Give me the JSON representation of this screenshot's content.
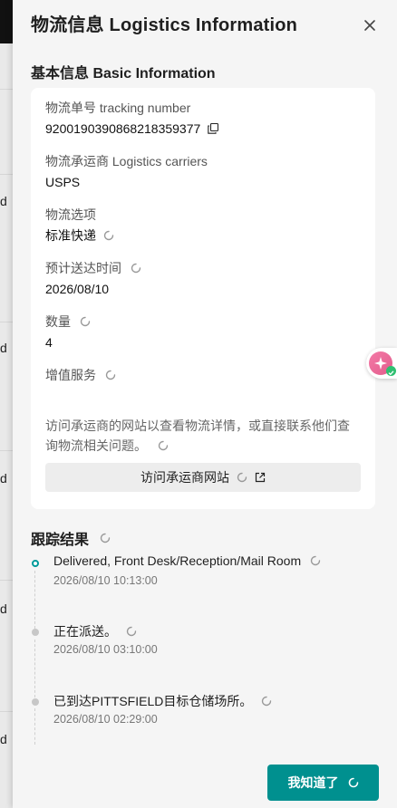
{
  "background": {
    "row_letter": "d"
  },
  "drawer": {
    "title": "物流信息  Logistics Information"
  },
  "basic": {
    "section_title": "基本信息  Basic Information",
    "tracking_label": "物流单号  tracking number",
    "tracking_value": "9200190390868218359377",
    "carrier_label": "物流承运商  Logistics carriers",
    "carrier_value": "USPS",
    "option_label": "物流选项",
    "option_value": "标准快递",
    "eta_label": "预计送达时间",
    "eta_value": "2026/08/10",
    "qty_label": "数量",
    "qty_value": "4",
    "vas_label": "增值服务",
    "note": "访问承运商的网站以查看物流详情，或直接联系他们查询物流相关问题。",
    "visit_button": "访问承运商网站"
  },
  "tracking": {
    "section_title": "跟踪结果",
    "events": [
      {
        "title": "Delivered, Front Desk/Reception/Mail Room",
        "time": "2026/08/10 10:13:00"
      },
      {
        "title": "正在派送。",
        "time": "2026/08/10 03:10:00"
      },
      {
        "title": "已到达PITTSFIELD目标仓储场所。",
        "time": "2026/08/10 02:29:00"
      }
    ]
  },
  "footer": {
    "ok_button": "我知道了"
  },
  "colors": {
    "accent": "#00908f",
    "timeline_active": "#009a9a"
  }
}
